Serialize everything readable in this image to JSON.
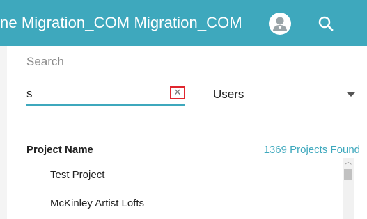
{
  "header": {
    "title": "ne Migration_COM Migration_COM",
    "avatar_icon": "user-avatar-icon",
    "search_icon": "search-icon",
    "bg_color": "#3ea8bd"
  },
  "search": {
    "label": "Search",
    "value": "s",
    "clear_icon": "close-icon",
    "filter_selected": "Users"
  },
  "results": {
    "column_header": "Project Name",
    "found_text": "1369 Projects Found",
    "items": [
      {
        "label": "Test Project"
      },
      {
        "label": "McKinley Artist Lofts"
      }
    ]
  },
  "colors": {
    "accent": "#3ea8bd",
    "highlight_box": "#e0262e"
  }
}
